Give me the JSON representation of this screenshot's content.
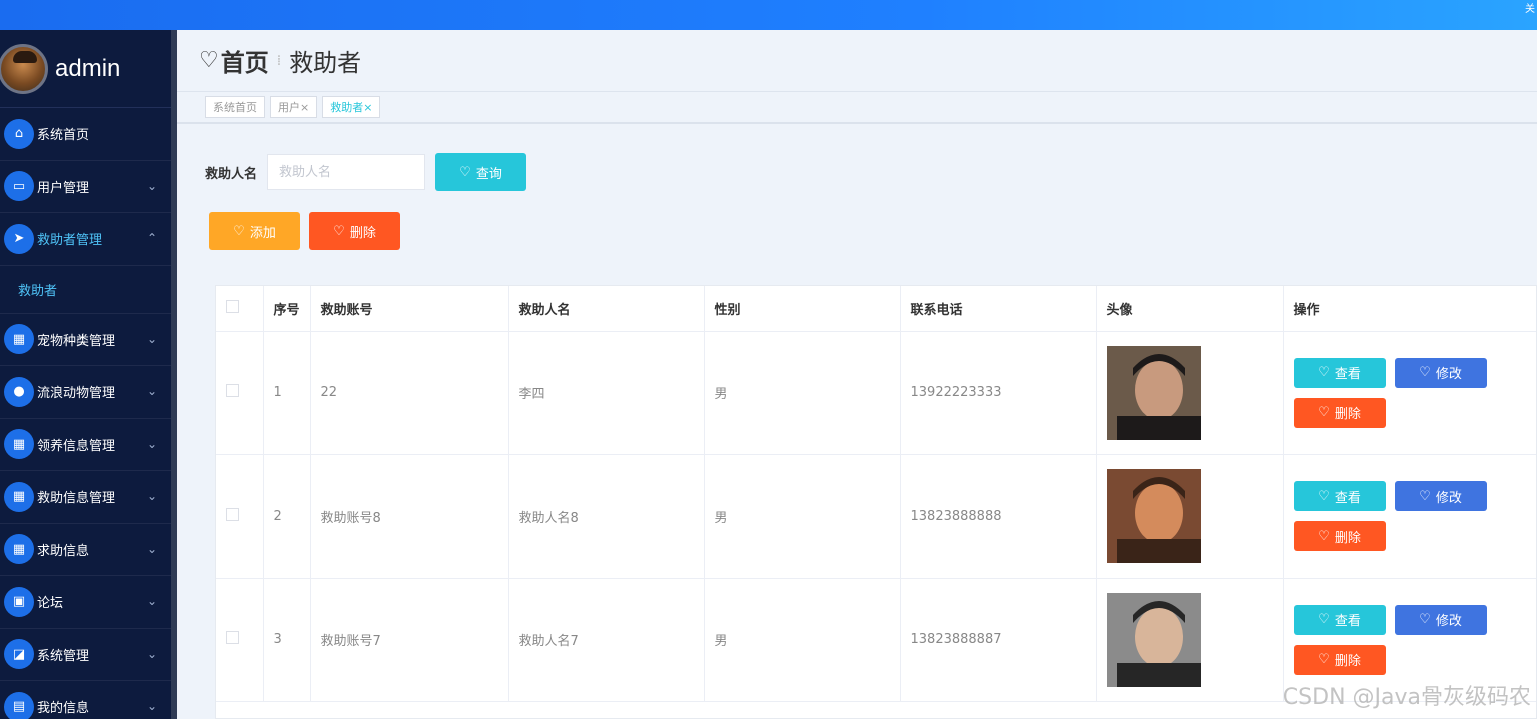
{
  "topbar": {
    "corner_text": "关"
  },
  "profile": {
    "name": "admin"
  },
  "sidebar": {
    "items": [
      {
        "label": "系统首页",
        "icon": "home-icon",
        "glyph": "⌂",
        "chevron": ""
      },
      {
        "label": "用户管理",
        "icon": "monitor-icon",
        "glyph": "▭",
        "chevron": "⌄"
      },
      {
        "label": "救助者管理",
        "icon": "send-icon",
        "glyph": "➤",
        "chevron": "⌃",
        "active": true
      },
      {
        "label": "宠物种类管理",
        "icon": "grid-icon",
        "glyph": "▦",
        "chevron": "⌄"
      },
      {
        "label": "流浪动物管理",
        "icon": "user-icon",
        "glyph": "●",
        "chevron": "⌄"
      },
      {
        "label": "领养信息管理",
        "icon": "grid-icon",
        "glyph": "▦",
        "chevron": "⌄"
      },
      {
        "label": "救助信息管理",
        "icon": "apps-icon",
        "glyph": "▦",
        "chevron": "⌄"
      },
      {
        "label": "求助信息",
        "icon": "grid-icon",
        "glyph": "▦",
        "chevron": "⌄"
      },
      {
        "label": "论坛",
        "icon": "briefcase-icon",
        "glyph": "▣",
        "chevron": "⌄"
      },
      {
        "label": "系统管理",
        "icon": "chart-icon",
        "glyph": "◪",
        "chevron": "⌄"
      },
      {
        "label": "我的信息",
        "icon": "wallet-icon",
        "glyph": "▤",
        "chevron": "⌄"
      }
    ],
    "subitem": "救助者"
  },
  "header": {
    "home": "首页",
    "current": "救助者"
  },
  "tags": [
    "系统首页",
    "用户×",
    "救助者×"
  ],
  "search": {
    "label": "救助人名",
    "placeholder": "救助人名",
    "button": "查询"
  },
  "actions": {
    "add": "添加",
    "delete": "删除"
  },
  "table": {
    "columns": [
      "序号",
      "救助账号",
      "救助人名",
      "性别",
      "联系电话",
      "头像",
      "操作"
    ],
    "rows": [
      {
        "no": "1",
        "account": "22",
        "name": "李四",
        "gender": "男",
        "phone": "13922223333"
      },
      {
        "no": "2",
        "account": "救助账号8",
        "name": "救助人名8",
        "gender": "男",
        "phone": "13823888888"
      },
      {
        "no": "3",
        "account": "救助账号7",
        "name": "救助人名7",
        "gender": "男",
        "phone": "13823888887"
      }
    ],
    "ops": {
      "view": "查看",
      "edit": "修改",
      "delete": "删除"
    }
  },
  "watermark": "CSDN @Java骨灰级码农",
  "colors": {
    "teal": "#26c6da",
    "orange": "#ffa726",
    "red": "#ff5722",
    "blue": "#3f74e0",
    "sidebar": "#0d1b3e"
  }
}
